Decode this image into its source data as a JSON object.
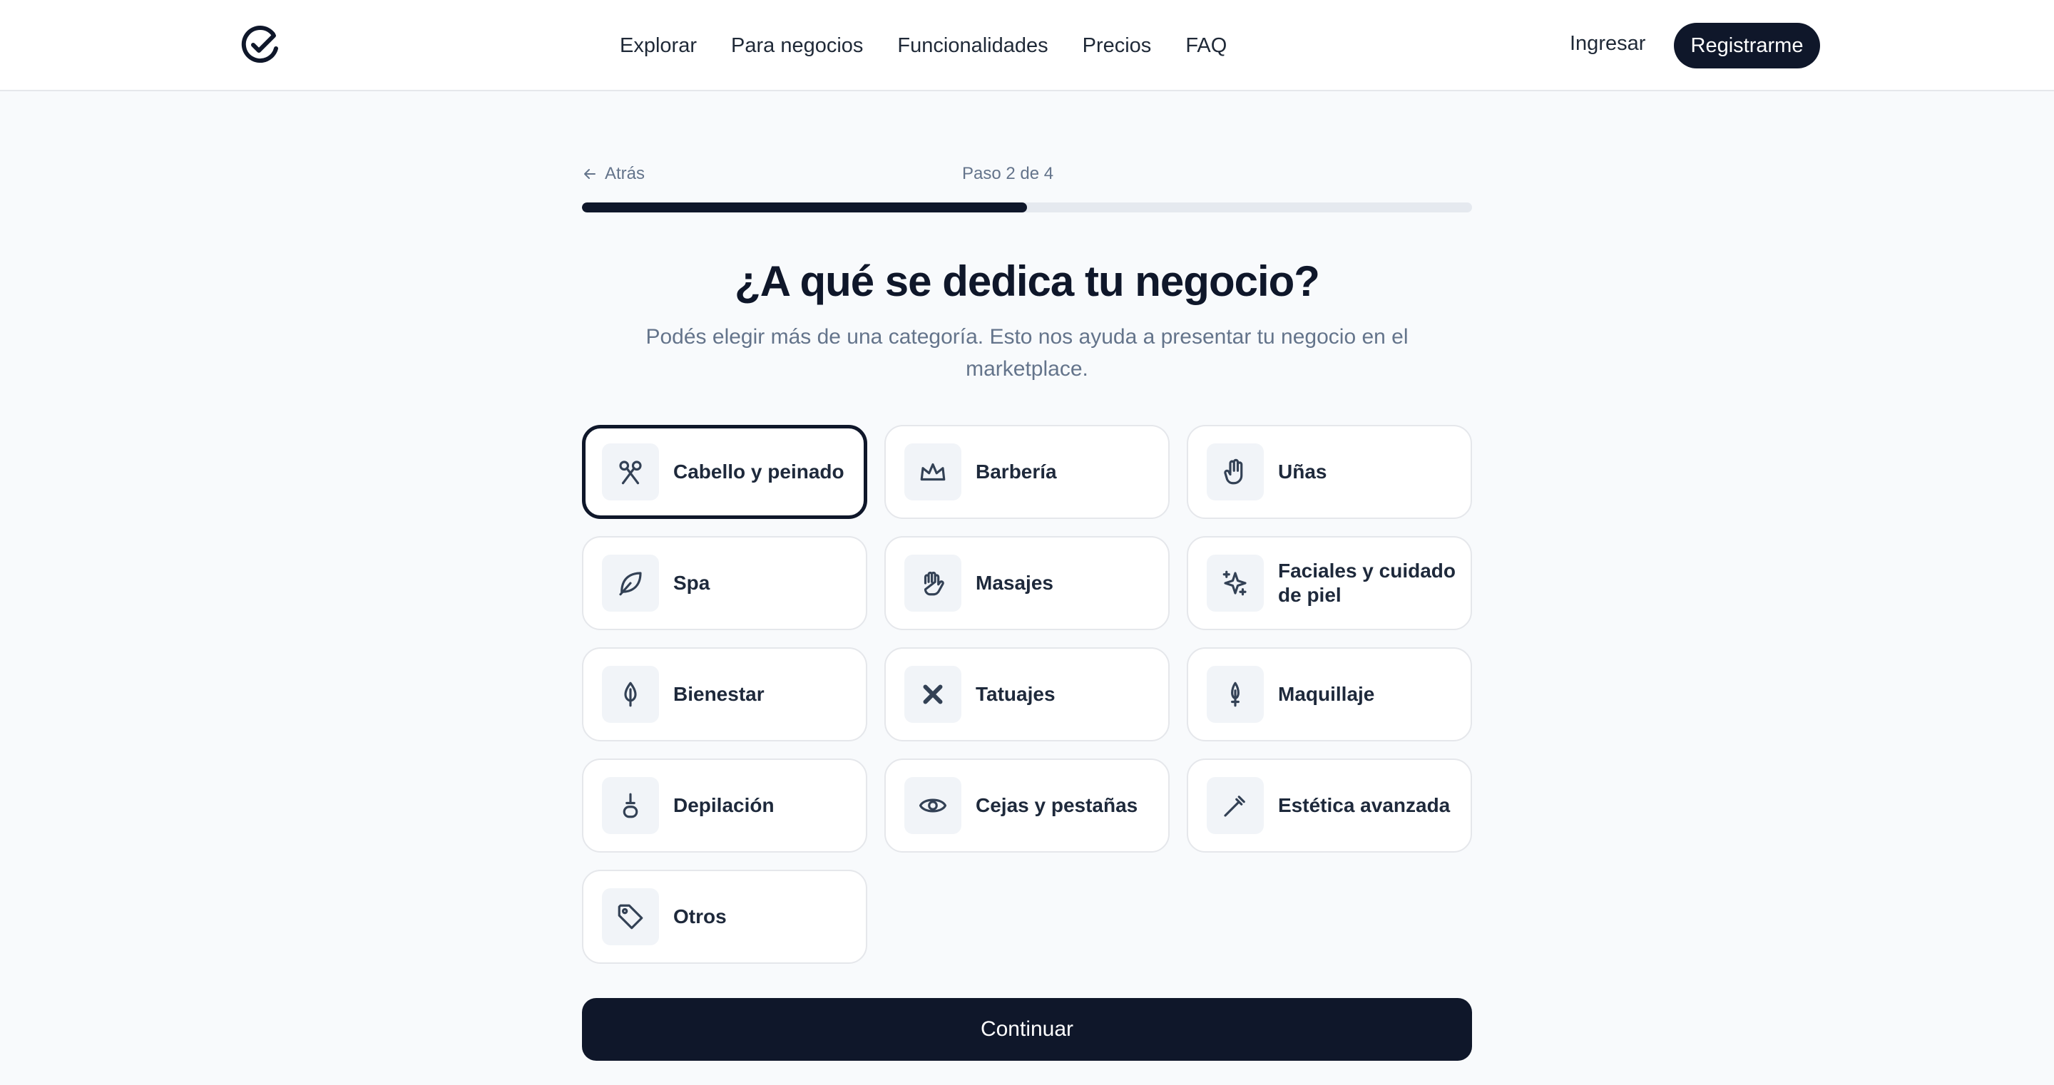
{
  "header": {
    "logo_icon": "check-circle-logo-icon",
    "nav": [
      {
        "label": "Explorar"
      },
      {
        "label": "Para negocios"
      },
      {
        "label": "Funcionalidades"
      },
      {
        "label": "Precios"
      },
      {
        "label": "FAQ"
      }
    ],
    "login_label": "Ingresar",
    "register_label": "Registrarme"
  },
  "progress": {
    "back_label": "Atrás",
    "back_icon": "arrow-left-icon",
    "step_label": "Paso 2 de 4",
    "current_step": 2,
    "total_steps": 4,
    "fraction": 0.5
  },
  "main": {
    "title": "¿A qué se dedica tu negocio?",
    "subtitle": "Podés elegir más de una categoría. Esto nos ayuda a presentar tu negocio en el marketplace."
  },
  "categories": [
    {
      "label": "Cabello y peinado",
      "icon": "scissors-icon",
      "selected": true
    },
    {
      "label": "Barbería",
      "icon": "crown-icon",
      "selected": false
    },
    {
      "label": "Uñas",
      "icon": "hand-icon",
      "selected": false
    },
    {
      "label": "Spa",
      "icon": "leaf-icon",
      "selected": false
    },
    {
      "label": "Masajes",
      "icon": "massage-hand-icon",
      "selected": false
    },
    {
      "label": "Faciales y cuidado de piel",
      "icon": "sparkles-icon",
      "selected": false
    },
    {
      "label": "Bienestar",
      "icon": "lotus-icon",
      "selected": false
    },
    {
      "label": "Tatuajes",
      "icon": "tattoo-cross-icon",
      "selected": false
    },
    {
      "label": "Maquillaje",
      "icon": "lipstick-icon",
      "selected": false
    },
    {
      "label": "Depilación",
      "icon": "wax-jar-icon",
      "selected": false
    },
    {
      "label": "Cejas y pestañas",
      "icon": "eye-icon",
      "selected": false
    },
    {
      "label": "Estética avanzada",
      "icon": "laser-pen-icon",
      "selected": false
    },
    {
      "label": "Otros",
      "icon": "tag-icon",
      "selected": false
    }
  ],
  "continue_label": "Continuar",
  "colors": {
    "primary": "#0f172a",
    "background": "#f8fafc",
    "muted_text": "#64748b",
    "border": "#e5e7eb",
    "icon_tile": "#f1f4f8"
  }
}
